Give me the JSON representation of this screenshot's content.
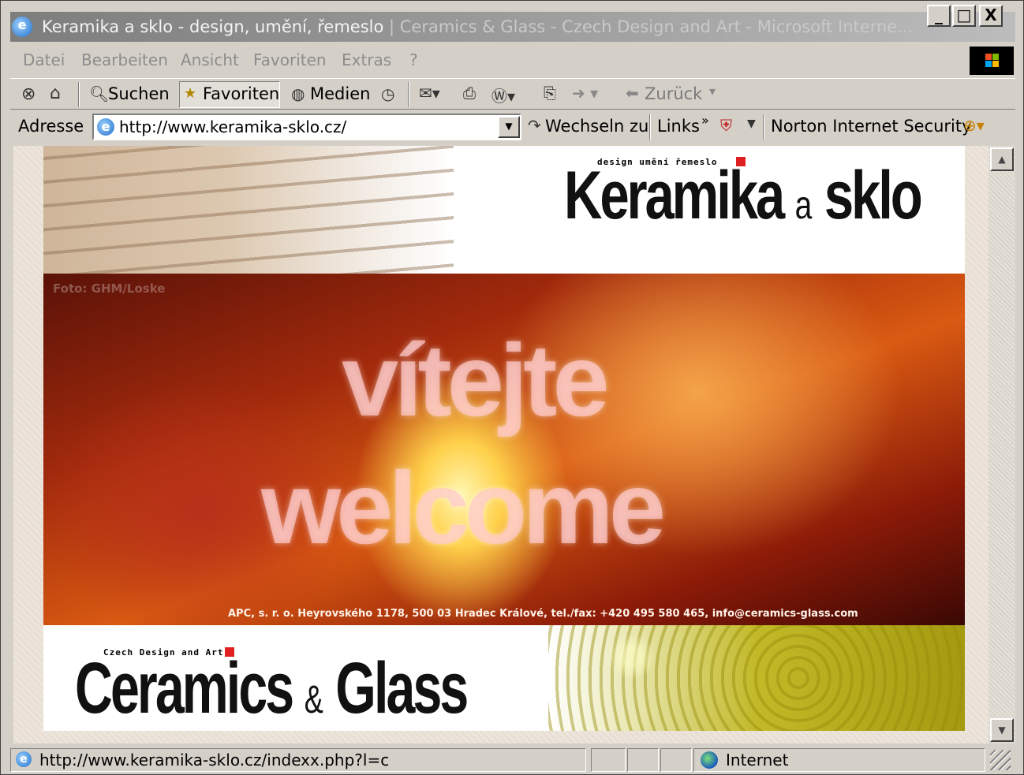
{
  "window": {
    "title": "Keramika a sklo - design, umění, řemeslo | Ceramics & Glass - Czech Design and Art - Microsoft Interne...",
    "title_main": "Keramika a sklo - design, umění, řemeslo",
    "title_rest": " | Ceramics & Glass - Czech Design and Art - Microsoft Interne...",
    "controls": [
      "_",
      "□",
      "X"
    ]
  },
  "menu": {
    "items": [
      "Datei",
      "Bearbeiten",
      "Ansicht",
      "Favoriten",
      "Extras",
      "?"
    ]
  },
  "toolbar": {
    "search_label": "Suchen",
    "favorites_label": "Favoriten",
    "media_label": "Medien",
    "back_label": "Zurück"
  },
  "address": {
    "label": "Adresse",
    "url": "http://www.keramika-sklo.cz/",
    "go_label": "Wechseln zu",
    "links_label": "Links",
    "links_more": "»",
    "norton_label": "Norton Internet Security"
  },
  "page": {
    "logo_cz_sub": "design umění řemeslo",
    "logo_cz_word1": "Keramika",
    "logo_cz_and": "a",
    "logo_cz_word2": "sklo",
    "foto_credit": "Foto: GHM/Loske",
    "welcome_cz": "vítejte",
    "welcome_en": "welcome",
    "contact_line": "APC, s. r. o. Heyrovského 1178, 500 03 Hradec Králové, tel./fax: +420 495 580 465, info@ceramics-glass.com",
    "logo_en_sub": "Czech Design and Art",
    "logo_en_word1": "Ceramics",
    "logo_en_and": "&",
    "logo_en_word2": "Glass"
  },
  "status": {
    "url": "http://www.keramika-sklo.cz/indexx.php?l=c",
    "zone": "Internet"
  },
  "icons": {
    "stop": "stop-icon",
    "home": "home-icon",
    "search": "search-icon",
    "favorites": "favorites-icon",
    "media": "media-icon",
    "history": "history-icon",
    "mail": "mail-icon",
    "print": "print-icon",
    "edit": "word-edit-icon",
    "forward": "forward-arrow-icon",
    "back": "back-arrow-icon"
  },
  "colors": {
    "title_bar_inactive": "#8a8a8a",
    "chrome": "#d4d0c8",
    "logo_red": "#e02020",
    "hero_fire": "#d95a12"
  }
}
